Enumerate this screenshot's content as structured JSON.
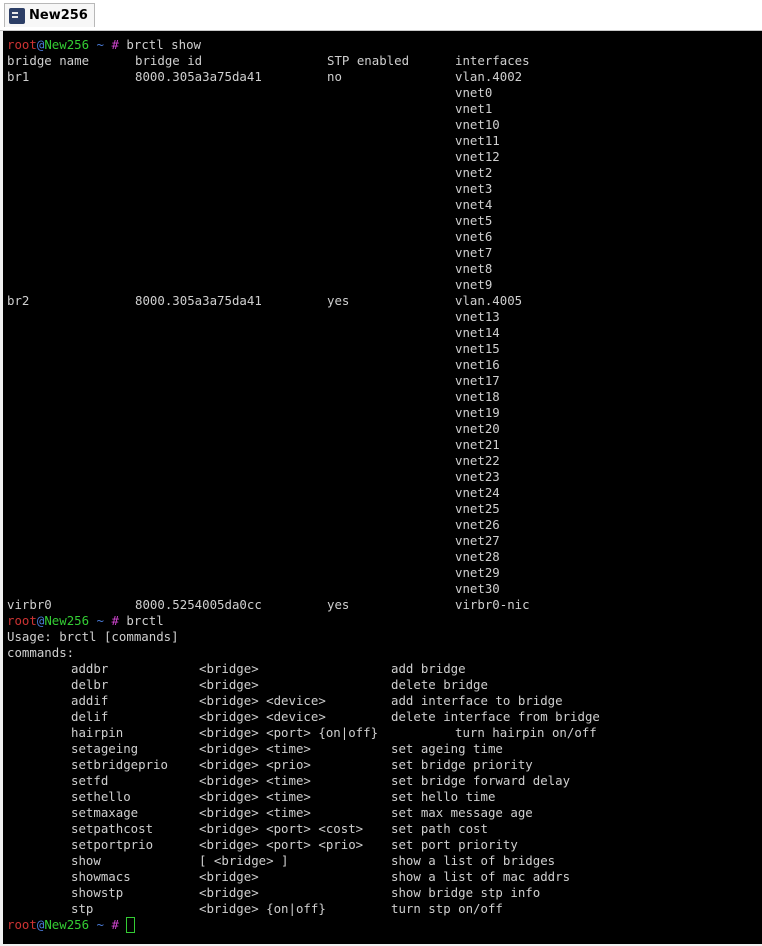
{
  "tab": {
    "title": "New256",
    "icon": "putty-terminal-icon"
  },
  "colors": {
    "user": "#cc3333",
    "host": "#33cc33",
    "path": "#4a7bd8",
    "hash": "#cc44cc",
    "text": "#cfcfcf",
    "background": "#000000"
  },
  "prompt": {
    "user": "root",
    "at": "@",
    "host": "New256",
    "path": "~",
    "symbol": "#"
  },
  "commands": {
    "first": "brctl show",
    "second": "brctl"
  },
  "bridges_header": [
    "bridge name",
    "bridge id",
    "STP enabled",
    "interfaces"
  ],
  "bridges": [
    {
      "name": "br1",
      "id": "8000.305a3a75da41",
      "stp": "no",
      "interfaces": [
        "vlan.4002",
        "vnet0",
        "vnet1",
        "vnet10",
        "vnet11",
        "vnet12",
        "vnet2",
        "vnet3",
        "vnet4",
        "vnet5",
        "vnet6",
        "vnet7",
        "vnet8",
        "vnet9"
      ]
    },
    {
      "name": "br2",
      "id": "8000.305a3a75da41",
      "stp": "yes",
      "interfaces": [
        "vlan.4005",
        "vnet13",
        "vnet14",
        "vnet15",
        "vnet16",
        "vnet17",
        "vnet18",
        "vnet19",
        "vnet20",
        "vnet21",
        "vnet22",
        "vnet23",
        "vnet24",
        "vnet25",
        "vnet26",
        "vnet27",
        "vnet28",
        "vnet29",
        "vnet30"
      ]
    },
    {
      "name": "virbr0",
      "id": "8000.5254005da0cc",
      "stp": "yes",
      "interfaces": [
        "virbr0-nic"
      ]
    }
  ],
  "usage": {
    "usage_line": "Usage: brctl [commands]",
    "commands_label": "commands:"
  },
  "command_list": [
    {
      "name": "addbr",
      "args": "<bridge>",
      "desc": "add bridge"
    },
    {
      "name": "delbr",
      "args": "<bridge>",
      "desc": "delete bridge"
    },
    {
      "name": "addif",
      "args": "<bridge> <device>",
      "desc": "add interface to bridge"
    },
    {
      "name": "delif",
      "args": "<bridge> <device>",
      "desc": "delete interface from bridge"
    },
    {
      "name": "hairpin",
      "args": "<bridge> <port> {on|off}",
      "desc": "turn hairpin on/off"
    },
    {
      "name": "setageing",
      "args": "<bridge> <time>",
      "desc": "set ageing time"
    },
    {
      "name": "setbridgeprio",
      "args": "<bridge> <prio>",
      "desc": "set bridge priority"
    },
    {
      "name": "setfd",
      "args": "<bridge> <time>",
      "desc": "set bridge forward delay"
    },
    {
      "name": "sethello",
      "args": "<bridge> <time>",
      "desc": "set hello time"
    },
    {
      "name": "setmaxage",
      "args": "<bridge> <time>",
      "desc": "set max message age"
    },
    {
      "name": "setpathcost",
      "args": "<bridge> <port> <cost>",
      "desc": "set path cost"
    },
    {
      "name": "setportprio",
      "args": "<bridge> <port> <prio>",
      "desc": "set port priority"
    },
    {
      "name": "show",
      "args": "[ <bridge> ]",
      "desc": "show a list of bridges"
    },
    {
      "name": "showmacs",
      "args": "<bridge>",
      "desc": "show a list of mac addrs"
    },
    {
      "name": "showstp",
      "args": "<bridge>",
      "desc": "show bridge stp info"
    },
    {
      "name": "stp",
      "args": "<bridge> {on|off}",
      "desc": "turn stp on/off"
    }
  ]
}
